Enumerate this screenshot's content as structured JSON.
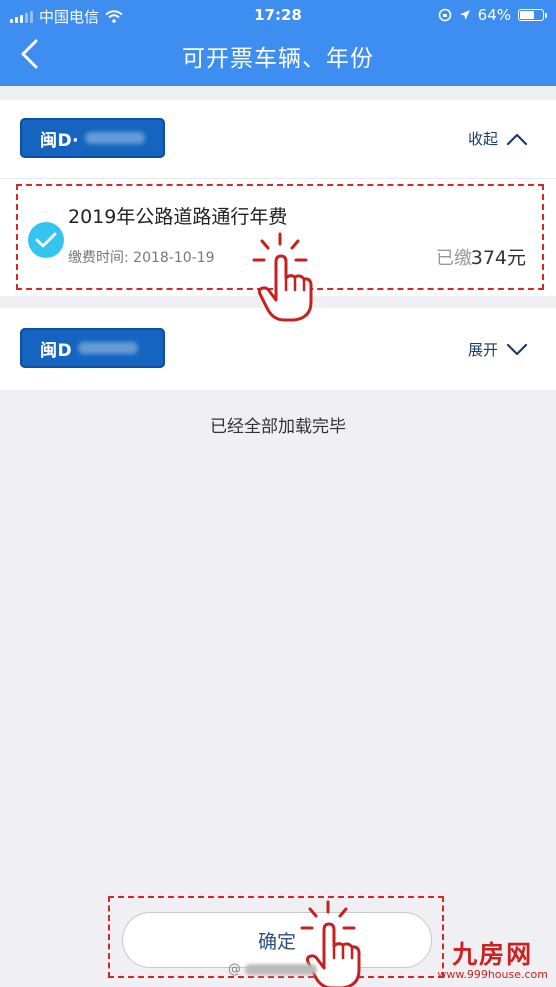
{
  "status_bar": {
    "carrier": "中国电信",
    "time": "17:28",
    "battery": "64%",
    "battery_level": 0.64
  },
  "nav": {
    "title": "可开票车辆、年份"
  },
  "vehicles": [
    {
      "plate_prefix": "闽D·",
      "toggle_label": "收起",
      "toggle_icon": "chevron-up-icon",
      "items": [
        {
          "title": "2019年公路道路通行年费",
          "time_label": "缴费时间: 2018-10-19",
          "status": "已缴",
          "amount": "374元",
          "selected": true
        }
      ]
    },
    {
      "plate_prefix": "闽D",
      "toggle_label": "展开",
      "toggle_icon": "chevron-down-icon"
    }
  ],
  "footer_text": "已经全部加载完毕",
  "confirm_label": "确定",
  "watermark": {
    "brand_big": "九房网",
    "brand_url": "www.999house.com",
    "weibo_prefix": "@"
  },
  "colors": {
    "nav_bg": "#3d8ef0",
    "plate_bg": "#1565c0",
    "check": "#35c4f0",
    "highlight": "#d42a2a"
  }
}
